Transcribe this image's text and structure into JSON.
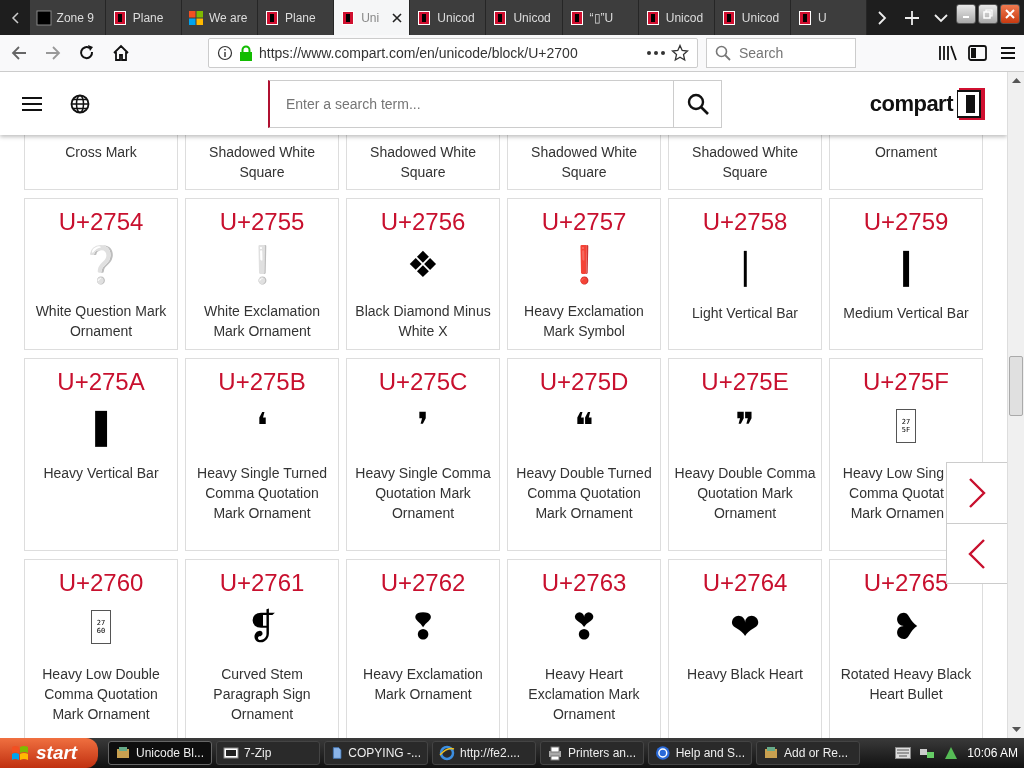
{
  "browser": {
    "tabs": [
      {
        "label": "Zone 9",
        "kind": "dark",
        "selected": false
      },
      {
        "label": "Plane",
        "kind": "compart",
        "selected": false
      },
      {
        "label": "We are",
        "kind": "windows",
        "selected": false
      },
      {
        "label": "Plane",
        "kind": "compart",
        "selected": false
      },
      {
        "label": "Uni",
        "kind": "compart",
        "selected": true
      },
      {
        "label": "Unicod",
        "kind": "compart",
        "selected": false
      },
      {
        "label": "Unicod",
        "kind": "compart",
        "selected": false
      },
      {
        "label": "“▯”U",
        "kind": "compart",
        "selected": false
      },
      {
        "label": "Unicod",
        "kind": "compart",
        "selected": false
      },
      {
        "label": "Unicod",
        "kind": "compart",
        "selected": false
      },
      {
        "label": "U",
        "kind": "compart",
        "selected": false
      }
    ],
    "url": "https://www.compart.com/en/unicode/block/U+2700",
    "search": {
      "placeholder": "Search"
    }
  },
  "site": {
    "search": {
      "placeholder": "Enter a search term..."
    },
    "logo": "compart"
  },
  "cut_row": [
    "Cross Mark",
    "Shadowed White Square",
    "Shadowed White Square",
    "Shadowed White Square",
    "Shadowed White Square",
    "Ornament"
  ],
  "cards": [
    {
      "code": "U+2754",
      "kind": "glyph",
      "glyph": "❔",
      "name": "White Question Mark Ornament"
    },
    {
      "code": "U+2755",
      "kind": "glyph",
      "glyph": "❕",
      "name": "White Exclamation Mark Ornament"
    },
    {
      "code": "U+2756",
      "kind": "glyph",
      "glyph": "❖",
      "name": "Black Diamond Minus White X"
    },
    {
      "code": "U+2757",
      "kind": "glyph",
      "glyph": "❗",
      "name": "Heavy Exclamation Mark Symbol"
    },
    {
      "code": "U+2758",
      "kind": "glyph",
      "glyph": "❘",
      "name": "Light Vertical Bar"
    },
    {
      "code": "U+2759",
      "kind": "glyph",
      "glyph": "❙",
      "name": "Medium Vertical Bar"
    },
    {
      "code": "U+275A",
      "kind": "glyph",
      "glyph": "❚",
      "name": "Heavy Vertical Bar"
    },
    {
      "code": "U+275B",
      "kind": "glyph",
      "glyph": "❛",
      "name": "Heavy Single Turned Comma Quotation Mark Ornament"
    },
    {
      "code": "U+275C",
      "kind": "glyph",
      "glyph": "❜",
      "name": "Heavy Single Comma Quotation Mark Ornament"
    },
    {
      "code": "U+275D",
      "kind": "glyph",
      "glyph": "❝",
      "name": "Heavy Double Turned Comma Quotation Mark Ornament"
    },
    {
      "code": "U+275E",
      "kind": "glyph",
      "glyph": "❞",
      "name": "Heavy Double Comma Quotation Mark Ornament"
    },
    {
      "code": "U+275F",
      "kind": "missing",
      "hex": [
        "27",
        "5F"
      ],
      "covered": true,
      "name_lines": [
        "Heavy Low Sing",
        "Comma Quotat",
        "Mark Ornamen"
      ]
    },
    {
      "code": "U+2760",
      "kind": "missing",
      "hex": [
        "27",
        "60"
      ],
      "name": "Heavy Low Double Comma Quotation Mark Ornament"
    },
    {
      "code": "U+2761",
      "kind": "glyph",
      "glyph": "❡",
      "name": "Curved Stem Paragraph Sign Ornament"
    },
    {
      "code": "U+2762",
      "kind": "glyph",
      "glyph": "❢",
      "name": "Heavy Exclamation Mark Ornament"
    },
    {
      "code": "U+2763",
      "kind": "glyph",
      "glyph": "❣",
      "name": "Heavy Heart Exclamation Mark Ornament"
    },
    {
      "code": "U+2764",
      "kind": "glyph",
      "glyph": "❤",
      "name": "Heavy Black Heart"
    },
    {
      "code": "U+2765",
      "kind": "glyph",
      "glyph": "❥",
      "name": "Rotated Heavy Black Heart Bullet"
    }
  ],
  "taskbar": {
    "start": "start",
    "tasks": [
      {
        "label": "Unicode Bl...",
        "kind": "app",
        "selected": true
      },
      {
        "label": "7-Zip",
        "kind": "zip",
        "selected": false
      },
      {
        "label": "COPYING -...",
        "kind": "doc",
        "selected": false
      },
      {
        "label": "http://fe2....",
        "kind": "ie",
        "selected": false
      },
      {
        "label": "Printers an...",
        "kind": "printer",
        "selected": false
      },
      {
        "label": "Help and S...",
        "kind": "help",
        "selected": false
      },
      {
        "label": "Add or Re...",
        "kind": "app",
        "selected": false
      }
    ],
    "clock": "10:06 AM"
  }
}
